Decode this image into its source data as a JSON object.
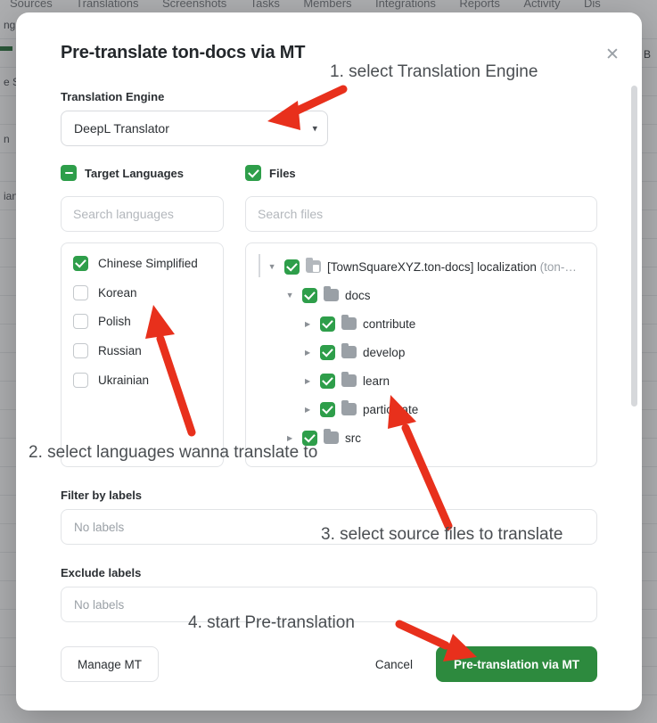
{
  "background": {
    "nav_items": [
      "Sources",
      "Translations",
      "Screenshots",
      "Tasks",
      "Members",
      "Integrations",
      "Reports",
      "Activity",
      "Dis"
    ],
    "rows": [
      "ng",
      "",
      "e S",
      "",
      "n",
      "",
      "ian",
      "",
      "",
      "",
      "",
      "",
      "",
      "",
      "",
      "",
      "",
      "",
      "",
      "",
      "",
      "",
      "",
      ""
    ],
    "filter_icon": "filter-icon",
    "filter_text": "B"
  },
  "modal": {
    "title": "Pre-translate ton-docs via MT",
    "close_icon": "✕",
    "engine": {
      "label": "Translation Engine",
      "selected": "DeepL Translator",
      "options": [
        "DeepL Translator"
      ],
      "caret_icon": "⌄"
    },
    "target_languages": {
      "header_label": "Target Languages",
      "header_state": "indeterminate",
      "search_placeholder": "Search languages",
      "search_value": "",
      "items": [
        {
          "label": "Chinese Simplified",
          "checked": true
        },
        {
          "label": "Korean",
          "checked": false
        },
        {
          "label": "Polish",
          "checked": false
        },
        {
          "label": "Russian",
          "checked": false
        },
        {
          "label": "Ukrainian",
          "checked": false
        }
      ]
    },
    "files": {
      "header_label": "Files",
      "header_state": "checked",
      "search_placeholder": "Search files",
      "search_value": "",
      "tree": [
        {
          "label": "[TownSquareXYZ.ton-docs] localization",
          "suffix": "(ton-…",
          "checked": true,
          "expanded": true,
          "depth": 0,
          "icon": "repo-folder-icon"
        },
        {
          "label": "docs",
          "suffix": "",
          "checked": true,
          "expanded": true,
          "depth": 1,
          "icon": "folder-icon"
        },
        {
          "label": "contribute",
          "suffix": "",
          "checked": true,
          "expanded": false,
          "depth": 2,
          "icon": "folder-icon"
        },
        {
          "label": "develop",
          "suffix": "",
          "checked": true,
          "expanded": false,
          "depth": 2,
          "icon": "folder-icon"
        },
        {
          "label": "learn",
          "suffix": "",
          "checked": true,
          "expanded": false,
          "depth": 2,
          "icon": "folder-icon"
        },
        {
          "label": "participate",
          "suffix": "",
          "checked": true,
          "expanded": false,
          "depth": 2,
          "icon": "folder-icon"
        },
        {
          "label": "src",
          "suffix": "",
          "checked": true,
          "expanded": false,
          "depth": 1,
          "icon": "folder-icon"
        }
      ]
    },
    "filter_labels": {
      "label": "Filter by labels",
      "placeholder": "No labels",
      "value": ""
    },
    "exclude_labels": {
      "label": "Exclude labels",
      "placeholder": "No labels",
      "value": ""
    },
    "footer": {
      "manage_mt": "Manage MT",
      "cancel": "Cancel",
      "submit": "Pre-translation via MT"
    }
  },
  "annotations": [
    {
      "text": "1. select Translation Engine"
    },
    {
      "text": "2. select languages wanna translate to"
    },
    {
      "text": "3. select source files to translate"
    },
    {
      "text": "4. start Pre-translation"
    }
  ],
  "colors": {
    "accent_green": "#2e9e4a",
    "button_green": "#2d8a3e",
    "annotation_red": "#e8301c",
    "text_dark": "#2b2f33",
    "text_muted": "#9aa0a6"
  }
}
